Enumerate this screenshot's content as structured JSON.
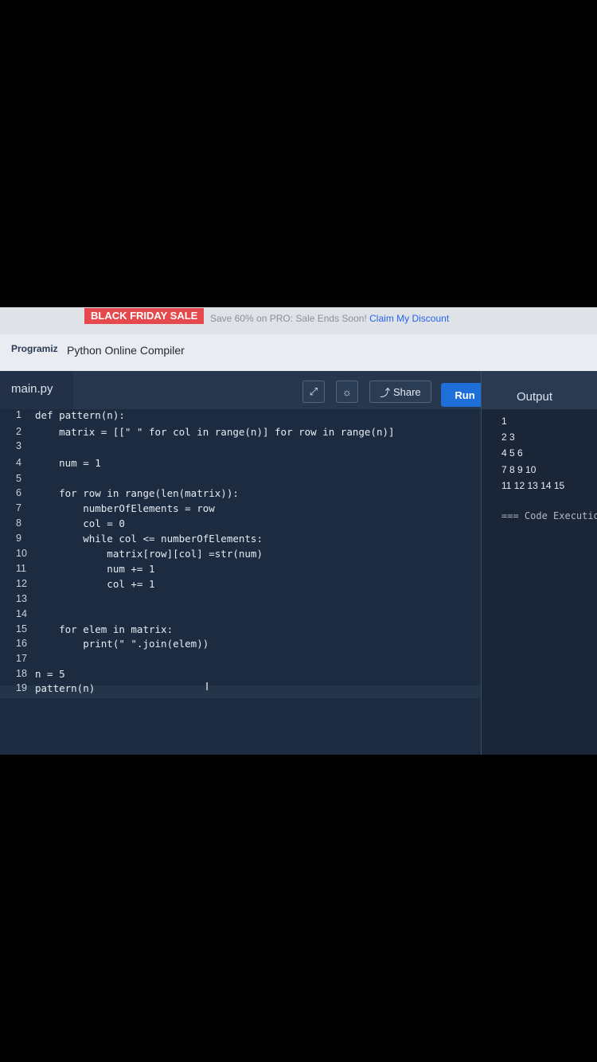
{
  "promo": {
    "badge": "BLACK FRIDAY SALE",
    "message": "Save 60% on PRO: Sale Ends Soon!",
    "claim": "Claim My Discount"
  },
  "brand": {
    "logo": "Programiz",
    "title": "Python Online Compiler"
  },
  "editor": {
    "tab": "main.py",
    "run": "Run",
    "share": "Share",
    "output_title": "Output"
  },
  "code": [
    {
      "ln": "1",
      "text": "def pattern(n):"
    },
    {
      "ln": "2",
      "text": "    matrix = [[\" \" for col in range(n)] for row in range(n)]"
    },
    {
      "ln": "3",
      "text": ""
    },
    {
      "ln": "4",
      "text": "    num = 1"
    },
    {
      "ln": "5",
      "text": ""
    },
    {
      "ln": "6",
      "text": "    for row in range(len(matrix)):"
    },
    {
      "ln": "7",
      "text": "        numberOfElements = row"
    },
    {
      "ln": "8",
      "text": "        col = 0"
    },
    {
      "ln": "9",
      "text": "        while col <= numberOfElements:"
    },
    {
      "ln": "10",
      "text": "            matrix[row][col] =str(num)"
    },
    {
      "ln": "11",
      "text": "            num += 1"
    },
    {
      "ln": "12",
      "text": "            col += 1"
    },
    {
      "ln": "13",
      "text": ""
    },
    {
      "ln": "14",
      "text": ""
    },
    {
      "ln": "15",
      "text": "    for elem in matrix:"
    },
    {
      "ln": "16",
      "text": "        print(\" \".join(elem))"
    },
    {
      "ln": "17",
      "text": ""
    },
    {
      "ln": "18",
      "text": "n = 5"
    },
    {
      "ln": "19",
      "text": "pattern(n)"
    }
  ],
  "output": [
    "1",
    "2 3",
    "4 5 6",
    "7 8 9 10",
    "11 12 13 14 15",
    "=== Code Executio"
  ]
}
